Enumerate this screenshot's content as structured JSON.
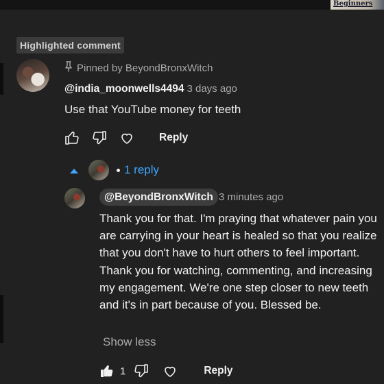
{
  "thumbnail": {
    "caption": "Beginners"
  },
  "highlight": {
    "label": "Highlighted comment"
  },
  "pinned": {
    "text": "Pinned by BeyondBronxWitch"
  },
  "comment": {
    "author": "@india_moonwells4494",
    "time": "3 days ago",
    "text": "Use that YouTube money for teeth",
    "reply_label": "Reply"
  },
  "replies": {
    "count_label": "1 reply"
  },
  "reply": {
    "author": "@BeyondBronxWitch",
    "time": "3 minutes ago",
    "text": "Thank you for that. I'm praying that whatever pain you are carrying in your heart is healed so that you realize that you don't have to hurt others to feel important. Thank you for watching, commenting, and increasing my engagement. We're one step closer to new teeth and it's in part because of you. Blessed be.",
    "show_less": "Show less",
    "like_count": "1",
    "reply_label": "Reply"
  },
  "icons": {
    "thumbs_up": "thumbs-up-icon",
    "thumbs_down": "thumbs-down-icon",
    "heart": "heart-icon",
    "pin": "pin-icon",
    "caret_up": "caret-up-icon"
  },
  "colors": {
    "background": "#212121",
    "text": "#f1f1f1",
    "secondary": "#aaaaaa",
    "link": "#3ea6ff",
    "chip": "#3d3d3d"
  }
}
